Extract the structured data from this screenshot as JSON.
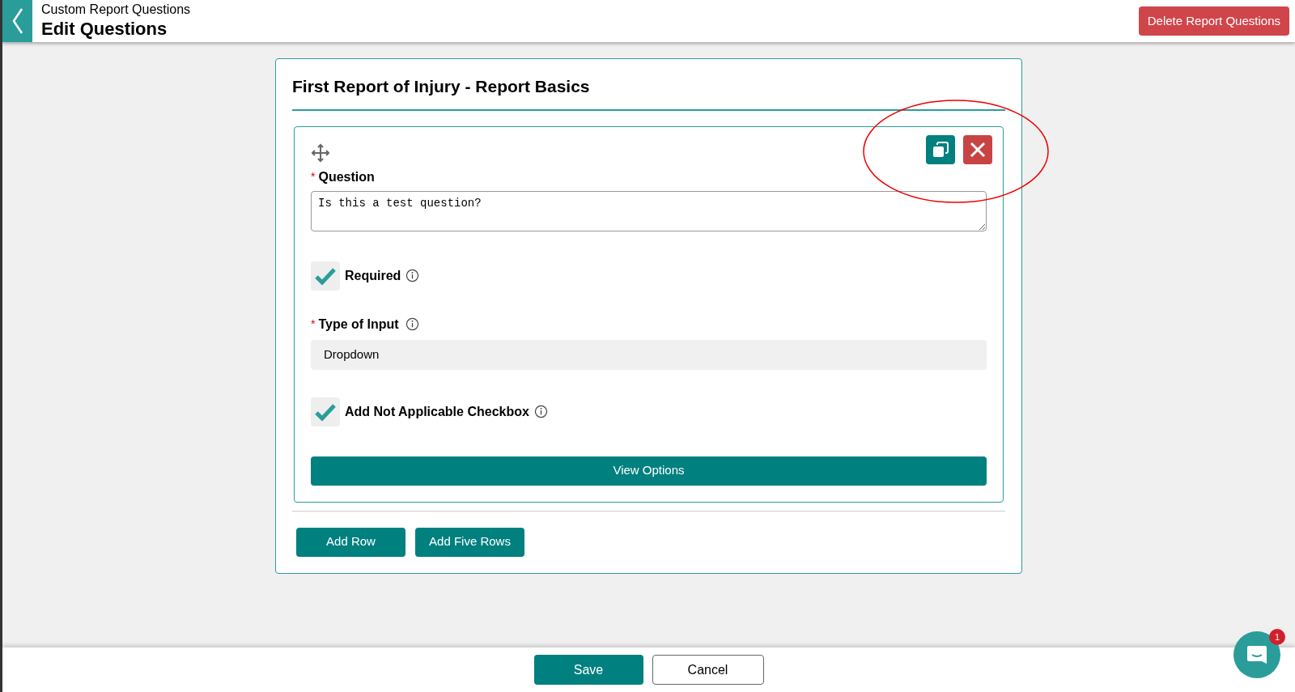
{
  "header": {
    "breadcrumb": "Custom Report Questions",
    "title": "Edit Questions",
    "delete_button": "Delete Report Questions"
  },
  "section": {
    "title": "First Report of Injury - Report Basics",
    "question": {
      "label": "Question",
      "required_mark": "*",
      "value": "Is this a test question?",
      "required": {
        "label": "Required",
        "checked": true
      },
      "input_type": {
        "label": "Type of Input",
        "required_mark": "*",
        "value": "Dropdown"
      },
      "not_applicable": {
        "label": "Add Not Applicable Checkbox",
        "checked": true
      },
      "view_options": "View Options"
    },
    "buttons": [
      "Add Row",
      "Add Five Rows"
    ]
  },
  "footer": {
    "buttons": [
      "Save",
      "Cancel"
    ]
  },
  "chat": {
    "badge": "1"
  }
}
